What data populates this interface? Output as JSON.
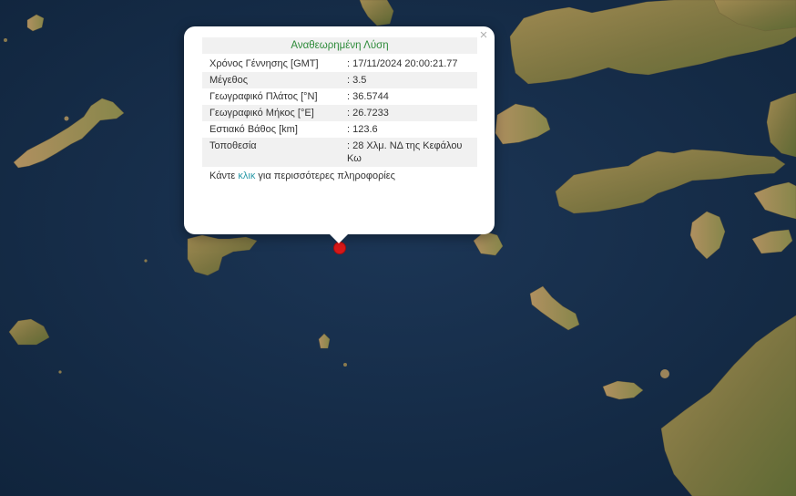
{
  "map": {
    "sea_color": "#142a44",
    "land_color": "#7d7440",
    "land_highlight": "#a38a52",
    "marker_color": "#d81818"
  },
  "popup": {
    "title": "Αναθεωρημένη Λύση",
    "title_color": "#2e8b3a",
    "close_icon": "×",
    "rows": [
      {
        "label": "Χρόνος Γέννησης [GMT]",
        "value": ": 17/11/2024 20:00:21.77"
      },
      {
        "label": "Μέγεθος",
        "value": ": 3.5"
      },
      {
        "label": "Γεωγραφικό Πλάτος [°N]",
        "value": ": 36.5744"
      },
      {
        "label": "Γεωγραφικό Μήκος [°E]",
        "value": ": 26.7233"
      },
      {
        "label": "Εστιακό Βάθος [km]",
        "value": ": 123.6"
      },
      {
        "label": "Τοποθεσία",
        "value": ": 28 Χλμ. ΝΔ της Κεφάλου Κω"
      }
    ],
    "footer_before": "Κάντε ",
    "footer_link": "κλικ",
    "footer_after": " για περισσότερες πληροφορίες",
    "link_color": "#2b9aa8"
  }
}
